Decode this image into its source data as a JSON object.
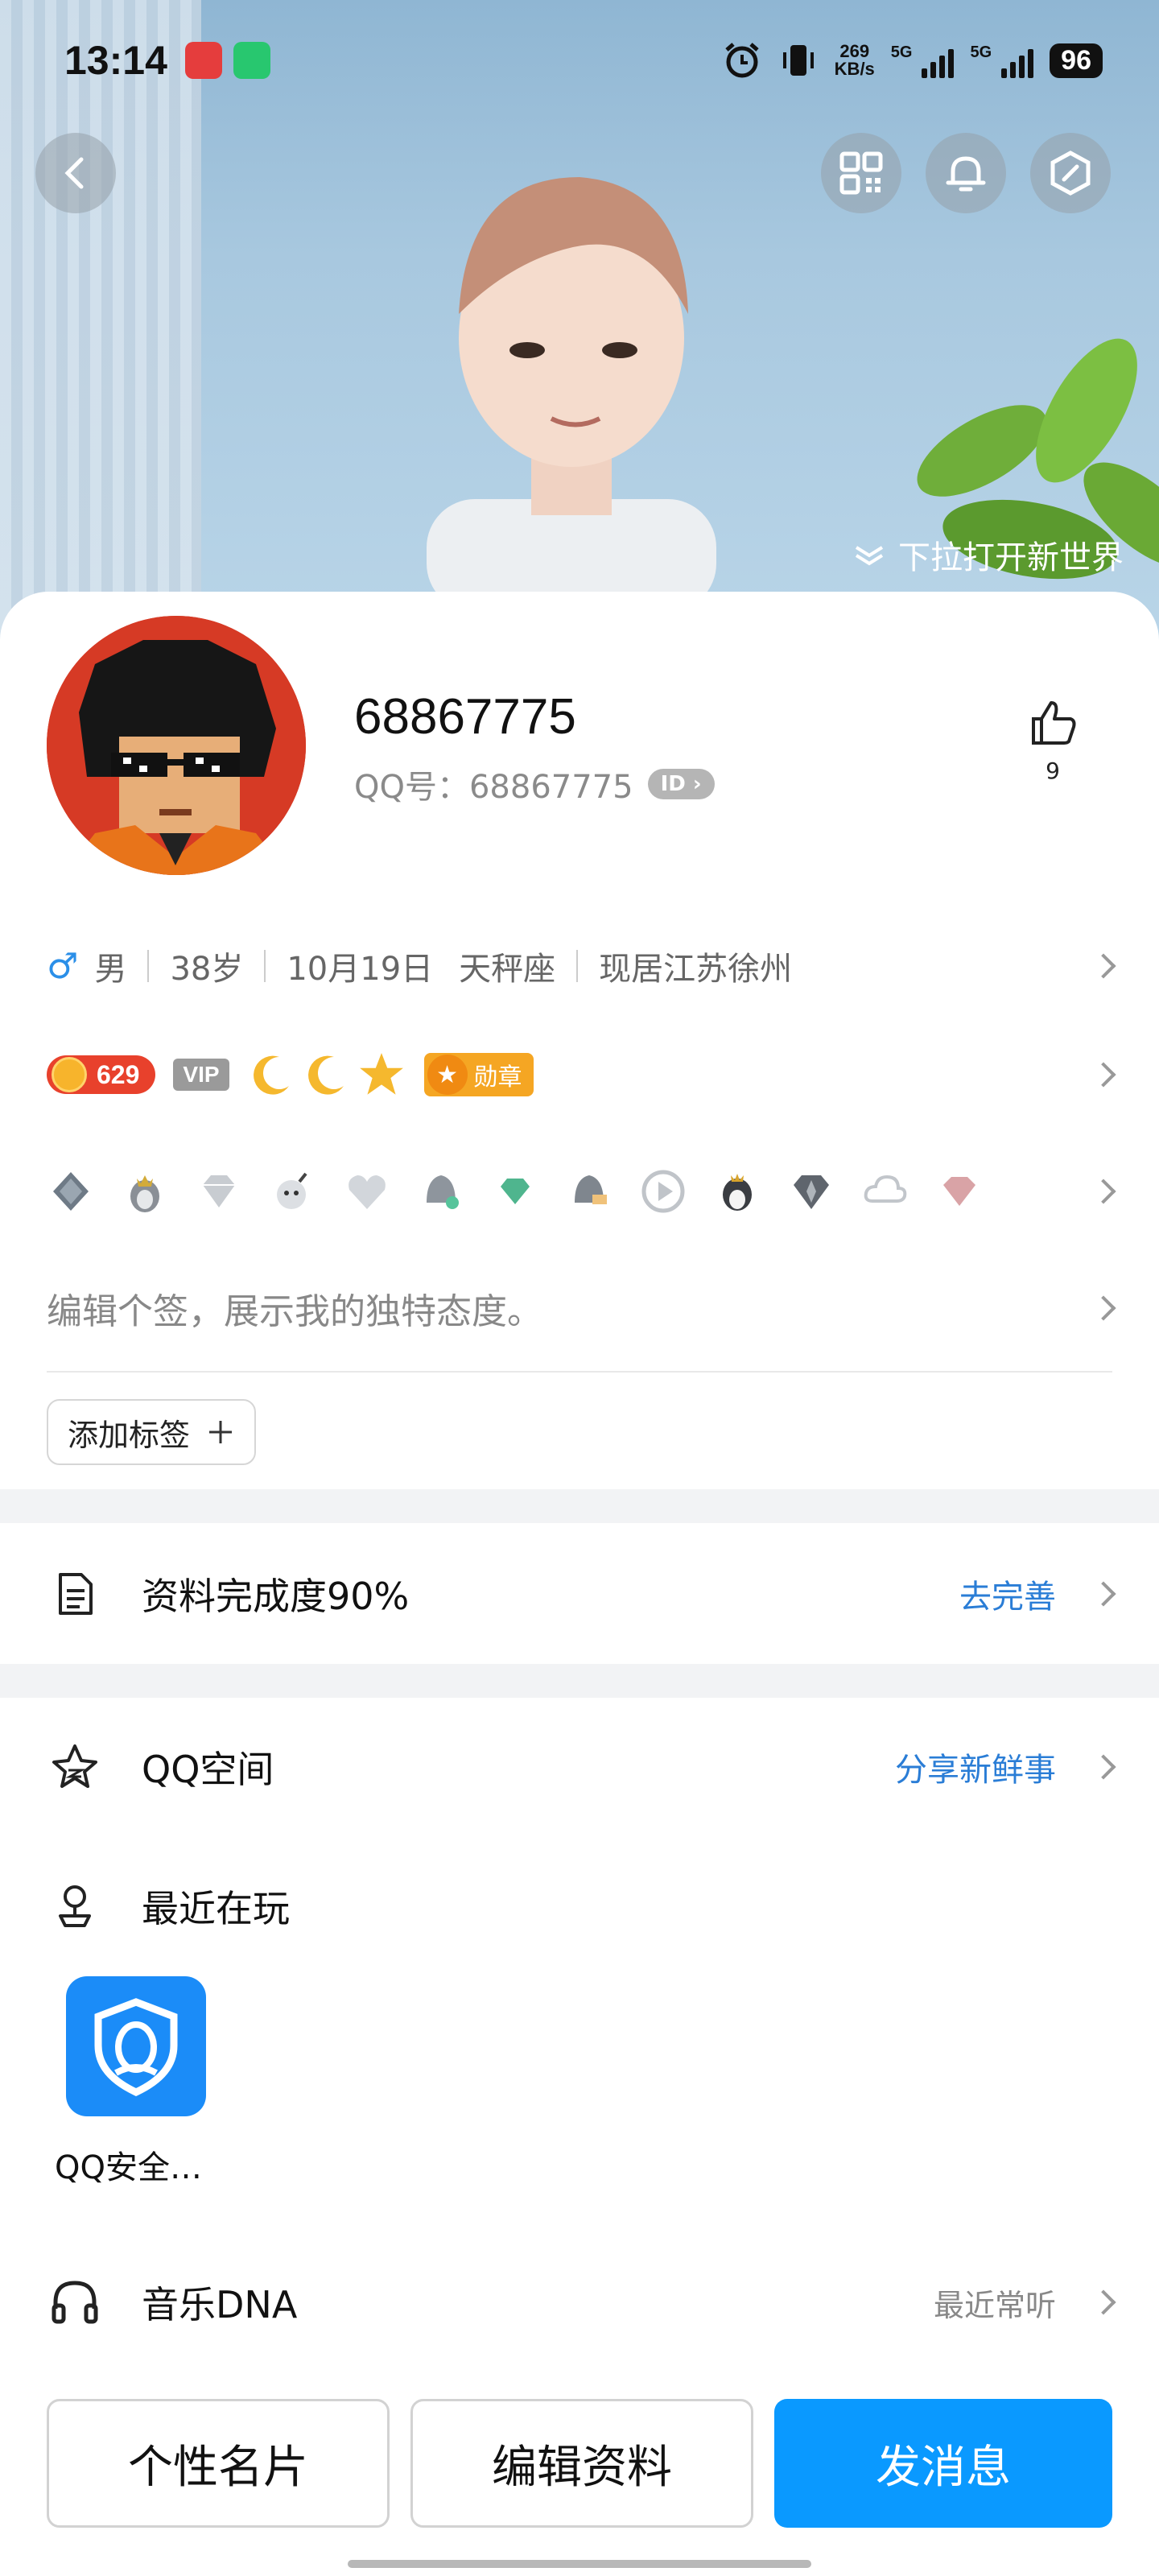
{
  "status_bar": {
    "time": "13:14",
    "net_speed_value": "269",
    "net_speed_unit": "KB/s",
    "network_1": "5G",
    "network_2": "5G",
    "battery": "96"
  },
  "header": {
    "pull_hint": "下拉打开新世界"
  },
  "profile": {
    "nickname": "68867775",
    "qq_label": "QQ号：68867775",
    "id_badge": "ID",
    "like_count": "9"
  },
  "info": {
    "gender_symbol": "♂",
    "gender": "男",
    "age": "38岁",
    "birthday": "10月19日",
    "zodiac": "天秤座",
    "location": "现居江苏徐州"
  },
  "badges": {
    "coin": "629",
    "vip": "VIP",
    "medal": "勋章"
  },
  "signature_placeholder": "编辑个签，展示我的独特态度。",
  "add_tag_label": "添加标签",
  "menu": {
    "completion": {
      "label": "资料完成度90%",
      "action": "去完善"
    },
    "qzone": {
      "label": "QQ空间",
      "action": "分享新鲜事"
    },
    "recent_play": {
      "label": "最近在玩"
    },
    "game_label": "QQ安全…",
    "music": {
      "label": "音乐DNA",
      "action": "最近常听"
    }
  },
  "actions": {
    "card": "个性名片",
    "edit": "编辑资料",
    "message": "发消息"
  },
  "colors": {
    "accent": "#0a99ff",
    "link": "#2a7dd6",
    "coin_red": "#e8412c"
  }
}
